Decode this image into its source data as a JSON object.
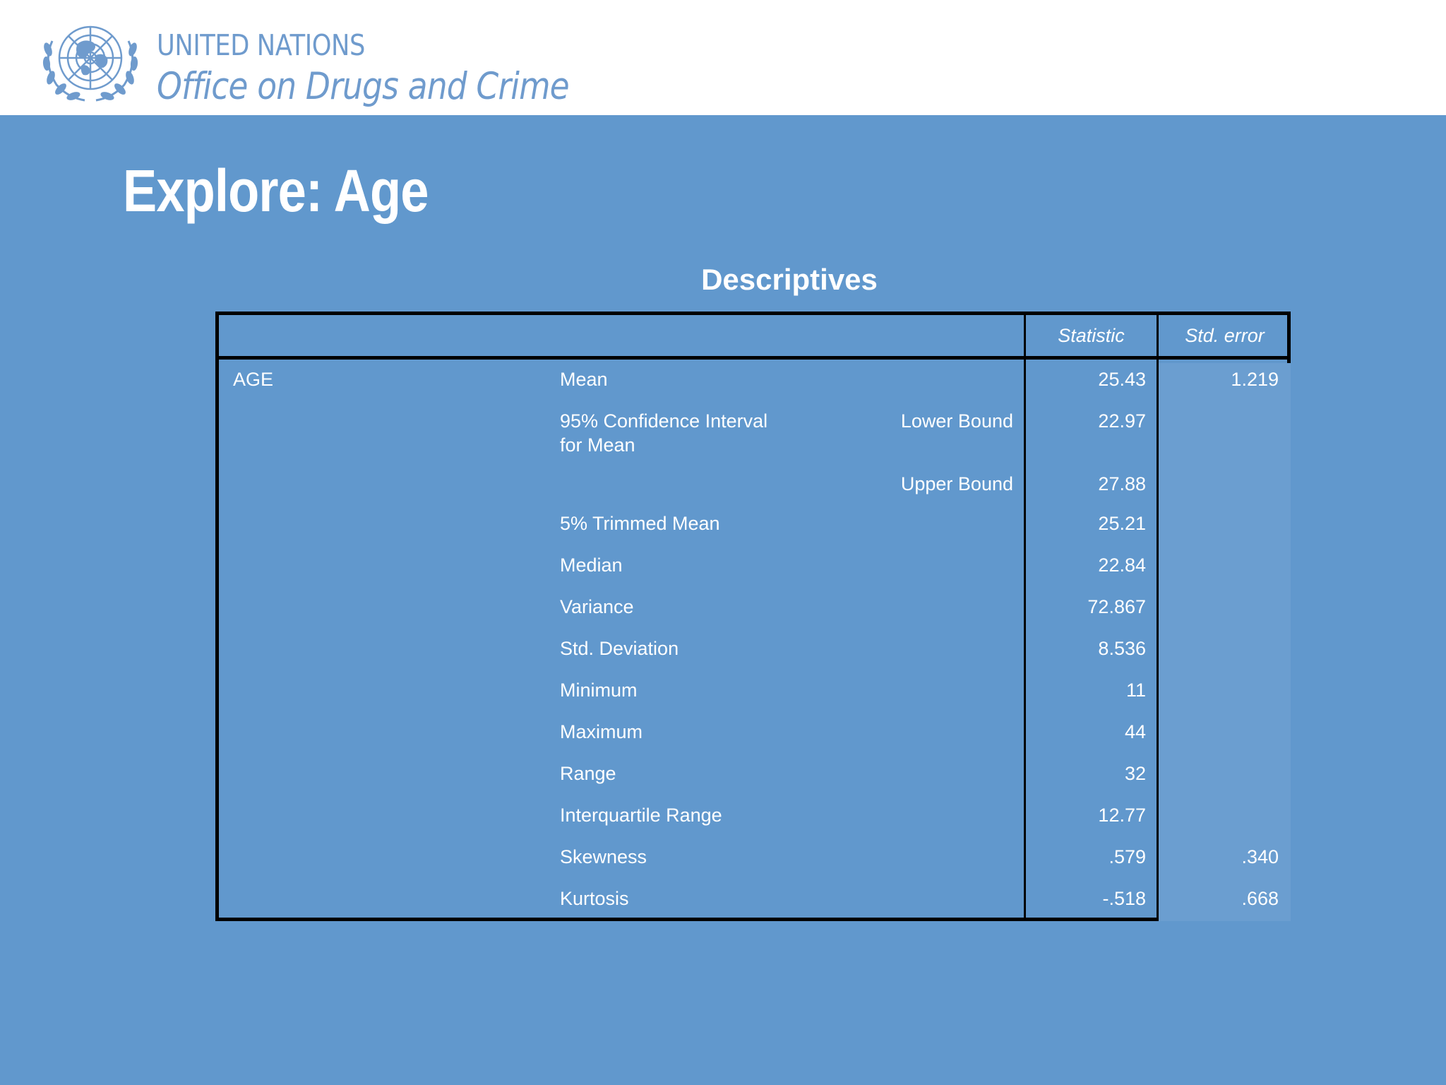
{
  "header": {
    "logo_icon": "un-emblem-icon",
    "org_line1": "UNITED NATIONS",
    "org_line2": "Office on Drugs and Crime"
  },
  "slide": {
    "title": "Explore: Age"
  },
  "table": {
    "title": "Descriptives",
    "columns": [
      "Statistic",
      "Std. error"
    ],
    "variable": "AGE",
    "rows": [
      {
        "label": "Mean",
        "sublabel": "",
        "statistic": "25.43",
        "std_error": "1.219"
      },
      {
        "label": "95% Confidence Interval",
        "label2": "for Mean",
        "sublabel": "Lower Bound",
        "statistic": "22.97",
        "std_error": ""
      },
      {
        "label": "",
        "sublabel": "Upper Bound",
        "statistic": "27.88",
        "std_error": ""
      },
      {
        "label": "5% Trimmed Mean",
        "sublabel": "",
        "statistic": "25.21",
        "std_error": ""
      },
      {
        "label": "Median",
        "sublabel": "",
        "statistic": "22.84",
        "std_error": ""
      },
      {
        "label": "Variance",
        "sublabel": "",
        "statistic": "72.867",
        "std_error": ""
      },
      {
        "label": "Std. Deviation",
        "sublabel": "",
        "statistic": "8.536",
        "std_error": ""
      },
      {
        "label": "Minimum",
        "sublabel": "",
        "statistic": "11",
        "std_error": ""
      },
      {
        "label": "Maximum",
        "sublabel": "",
        "statistic": "44",
        "std_error": ""
      },
      {
        "label": "Range",
        "sublabel": "",
        "statistic": "32",
        "std_error": ""
      },
      {
        "label": "Interquartile Range",
        "sublabel": "",
        "statistic": "12.77",
        "std_error": ""
      },
      {
        "label": "Skewness",
        "sublabel": "",
        "statistic": ".579",
        "std_error": ".340"
      },
      {
        "label": "Kurtosis",
        "sublabel": "",
        "statistic": "-.518",
        "std_error": ".668"
      }
    ]
  },
  "colors": {
    "background": "#6198cd",
    "header_bg": "#ffffff",
    "logo_blue": "#6f9bcd",
    "table_border": "#000000",
    "text": "#ffffff"
  }
}
